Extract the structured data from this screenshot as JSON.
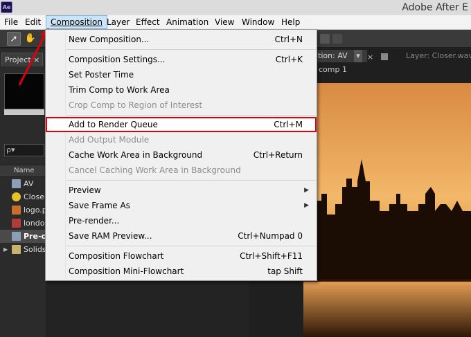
{
  "window": {
    "title": "Adobe After E",
    "app_icon": "Ae"
  },
  "menubar": {
    "items": [
      "File",
      "Edit",
      "Composition",
      "Layer",
      "Effect",
      "Animation",
      "View",
      "Window",
      "Help"
    ],
    "open_index": 2
  },
  "project_panel": {
    "tab": "Project",
    "search_placeholder": "ρ▾",
    "column_header": "Name",
    "items": [
      {
        "name": "AV",
        "icon": "comp-icon",
        "color": "#8b9fb8"
      },
      {
        "name": "Closer",
        "icon": "audio-icon",
        "color": "#e6c229"
      },
      {
        "name": "logo.p",
        "icon": "image-icon",
        "color": "#c96f2b"
      },
      {
        "name": "london",
        "icon": "image-icon",
        "color": "#b43a3a"
      },
      {
        "name": "Pre-c",
        "icon": "comp-icon",
        "color": "#8b9fb8"
      },
      {
        "name": "Solids",
        "icon": "folder-icon",
        "color": "#c8b26e"
      }
    ]
  },
  "comp_viewer": {
    "tab_comp": "ıtion: AV",
    "tab_layer": "Layer: Closer.wav",
    "subtitle": "comp 1"
  },
  "composition_menu": {
    "items": [
      {
        "label": "New Composition...",
        "shortcut": "Ctrl+N"
      },
      {
        "separator": true
      },
      {
        "label": "Composition Settings...",
        "shortcut": "Ctrl+K"
      },
      {
        "label": "Set Poster Time",
        "shortcut": ""
      },
      {
        "label": "Trim Comp to Work Area",
        "shortcut": ""
      },
      {
        "label": "Crop Comp to Region of Interest",
        "shortcut": "",
        "disabled": true
      },
      {
        "separator": true
      },
      {
        "label": "Add to Render Queue",
        "shortcut": "Ctrl+M",
        "highlighted": true
      },
      {
        "label": "Add Output Module",
        "shortcut": "",
        "disabled": true
      },
      {
        "label": "Cache Work Area in Background",
        "shortcut": "Ctrl+Return"
      },
      {
        "label": "Cancel Caching Work Area in Background",
        "shortcut": "",
        "disabled": true
      },
      {
        "separator": true
      },
      {
        "label": "Preview",
        "shortcut": "",
        "submenu": true
      },
      {
        "label": "Save Frame As",
        "shortcut": "",
        "submenu": true
      },
      {
        "label": "Pre-render...",
        "shortcut": ""
      },
      {
        "label": "Save RAM Preview...",
        "shortcut": "Ctrl+Numpad 0"
      },
      {
        "separator": true
      },
      {
        "label": "Composition Flowchart",
        "shortcut": "Ctrl+Shift+F11"
      },
      {
        "label": "Composition Mini-Flowchart",
        "shortcut": "tap Shift"
      }
    ]
  },
  "colors": {
    "highlight_outline": "#e0000c",
    "annotation_arrow": "#e0000c",
    "sunset": "#e39a4f"
  }
}
